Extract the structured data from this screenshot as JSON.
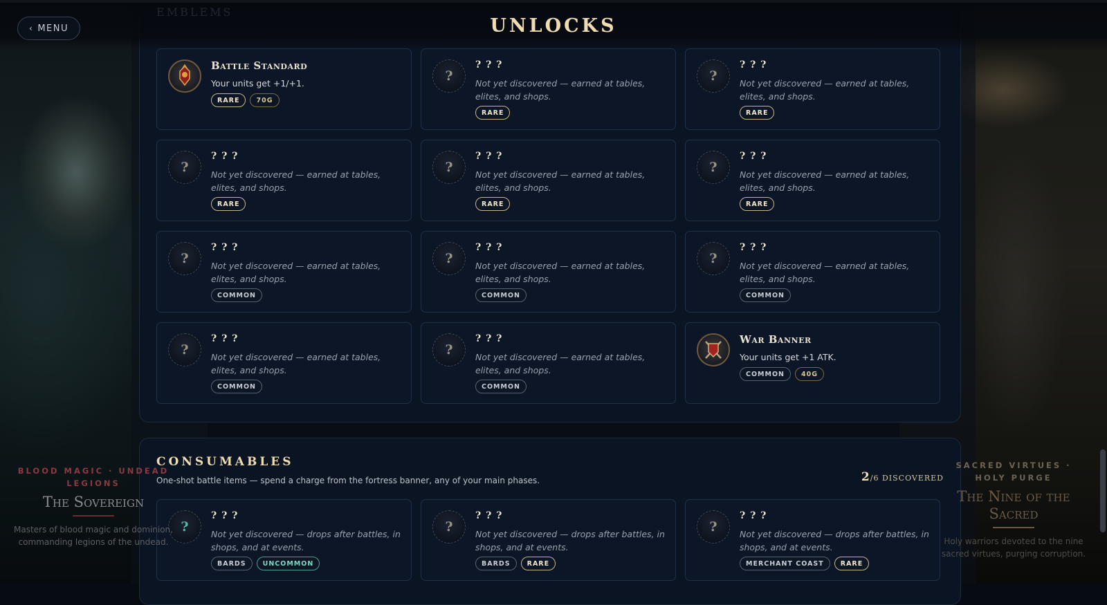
{
  "header": {
    "menu_label": "MENU",
    "title": "UNLOCKS",
    "ghost_section": "EMBLEMS"
  },
  "emblems": {
    "cards": [
      {
        "title": "Battle Standard",
        "named": true,
        "desc": "Your units get +1/+1.",
        "tags": [
          "RARE",
          "70G"
        ]
      },
      {
        "title": "? ? ?",
        "named": false,
        "desc": "Not yet discovered — earned at tables, elites, and shops.",
        "tags": [
          "RARE"
        ]
      },
      {
        "title": "? ? ?",
        "named": false,
        "desc": "Not yet discovered — earned at tables, elites, and shops.",
        "tags": [
          "RARE"
        ]
      },
      {
        "title": "? ? ?",
        "named": false,
        "desc": "Not yet discovered — earned at tables, elites, and shops.",
        "tags": [
          "RARE"
        ]
      },
      {
        "title": "? ? ?",
        "named": false,
        "desc": "Not yet discovered — earned at tables, elites, and shops.",
        "tags": [
          "RARE"
        ]
      },
      {
        "title": "? ? ?",
        "named": false,
        "desc": "Not yet discovered — earned at tables, elites, and shops.",
        "tags": [
          "RARE"
        ]
      },
      {
        "title": "? ? ?",
        "named": false,
        "desc": "Not yet discovered — earned at tables, elites, and shops.",
        "tags": [
          "COMMON"
        ]
      },
      {
        "title": "? ? ?",
        "named": false,
        "desc": "Not yet discovered — earned at tables, elites, and shops.",
        "tags": [
          "COMMON"
        ]
      },
      {
        "title": "? ? ?",
        "named": false,
        "desc": "Not yet discovered — earned at tables, elites, and shops.",
        "tags": [
          "COMMON"
        ]
      },
      {
        "title": "? ? ?",
        "named": false,
        "desc": "Not yet discovered — earned at tables, elites, and shops.",
        "tags": [
          "COMMON"
        ]
      },
      {
        "title": "? ? ?",
        "named": false,
        "desc": "Not yet discovered — earned at tables, elites, and shops.",
        "tags": [
          "COMMON"
        ]
      },
      {
        "title": "War Banner",
        "named": true,
        "desc": "Your units get +1 ATK.",
        "tags": [
          "COMMON",
          "40G"
        ]
      }
    ]
  },
  "consumables": {
    "title": "CONSUMABLES",
    "subtitle": "One-shot battle items — spend a charge from the fortress banner, any of your main phases.",
    "count_found": "2",
    "count_total": "/6 DISCOVERED",
    "cards": [
      {
        "title": "? ? ?",
        "desc": "Not yet discovered — drops after battles, in shops, and at events.",
        "tags": [
          "BARDS",
          "UNCOMMON"
        ]
      },
      {
        "title": "? ? ?",
        "desc": "Not yet discovered — drops after battles, in shops, and at events.",
        "tags": [
          "BARDS",
          "RARE"
        ]
      },
      {
        "title": "? ? ?",
        "desc": "Not yet discovered — drops after battles, in shops, and at events.",
        "tags": [
          "MERCHANT COAST",
          "RARE"
        ]
      }
    ]
  },
  "side_left": {
    "kicker": "BLOOD MAGIC · UNDEAD LEGIONS",
    "name": "The Sovereign",
    "desc": "Masters of blood magic and dominion, commanding legions of the undead."
  },
  "side_right": {
    "kicker": "SACRED VIRTUES · HOLY PURGE",
    "name": "The Nine of the Sacred",
    "desc": "Holy warriors devoted to the nine sacred virtues, purging corruption."
  },
  "colors": {
    "gold": "#efdcb3",
    "rare_border": "#c9b78a",
    "uncommon": "#4aa38f",
    "panel": "#0b1422"
  },
  "icons": {
    "menu": "chevron-left-icon",
    "unknown": "question-mark-icon",
    "battle_standard": "battle-standard-icon",
    "war_banner": "war-banner-icon"
  }
}
